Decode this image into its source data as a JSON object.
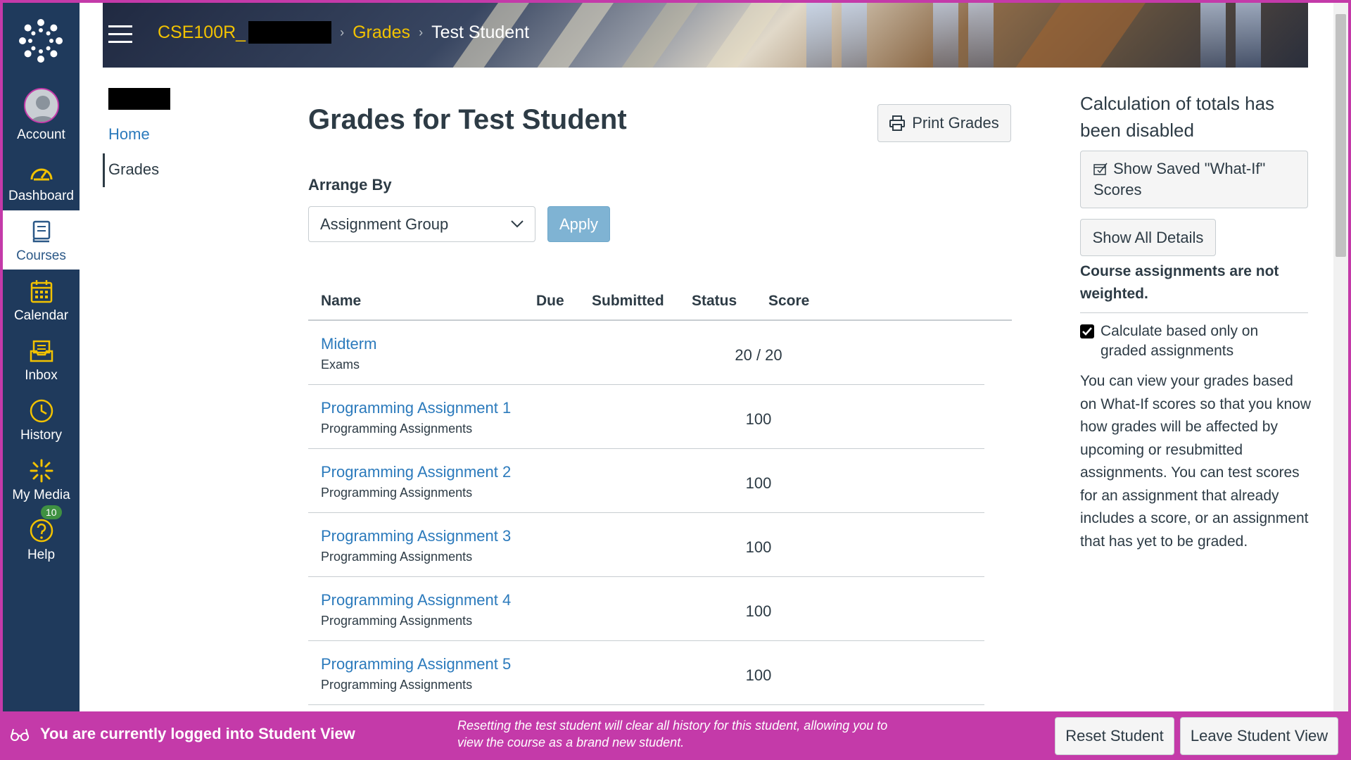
{
  "global_nav": {
    "items": [
      {
        "label": "Account"
      },
      {
        "label": "Dashboard"
      },
      {
        "label": "Courses"
      },
      {
        "label": "Calendar"
      },
      {
        "label": "Inbox"
      },
      {
        "label": "History"
      },
      {
        "label": "My Media"
      },
      {
        "label": "Help",
        "badge": "10"
      }
    ]
  },
  "breadcrumb": {
    "course": "CSE100R_",
    "section": "Grades",
    "current": "Test Student"
  },
  "course_nav": {
    "items": [
      {
        "label": "Home"
      },
      {
        "label": "Grades"
      }
    ]
  },
  "main": {
    "title": "Grades for Test Student",
    "print_label": "Print Grades",
    "arrange_label": "Arrange By",
    "arrange_value": "Assignment Group",
    "apply_label": "Apply",
    "columns": [
      "Name",
      "Due",
      "Submitted",
      "Status",
      "Score"
    ],
    "rows": [
      {
        "name": "Midterm",
        "group": "Exams",
        "score": "20 / 20"
      },
      {
        "name": "Programming Assignment 1",
        "group": "Programming Assignments",
        "score": "100"
      },
      {
        "name": "Programming Assignment 2",
        "group": "Programming Assignments",
        "score": "100"
      },
      {
        "name": "Programming Assignment 3",
        "group": "Programming Assignments",
        "score": "100"
      },
      {
        "name": "Programming Assignment 4",
        "group": "Programming Assignments",
        "score": "100"
      },
      {
        "name": "Programming Assignment 5",
        "group": "Programming Assignments",
        "score": "100"
      }
    ]
  },
  "sidebar": {
    "title": "Calculation of totals has been disabled",
    "whatif_button": "Show Saved \"What-If\" Scores",
    "details_button": "Show All Details",
    "weights_note": "Course assignments are not weighted.",
    "checkbox_label": "Calculate based only on graded assignments",
    "checkbox_checked": true,
    "whatif_text": "You can view your grades based on What-If scores so that you know how grades will be affected by upcoming or resubmitted assignments. You can test scores for an assignment that already includes a score, or an assignment that has yet to be graded."
  },
  "student_view": {
    "message": "You are currently logged into Student View",
    "note": "Resetting the test student will clear all history for this student, allowing you to view the course as a brand new student.",
    "reset_label": "Reset Student",
    "leave_label": "Leave Student View"
  },
  "colors": {
    "nav_bg": "#1f3a5c",
    "accent_yellow": "#f2c200",
    "link": "#2b7abc",
    "student_view": "#c43aa9",
    "apply_bg": "#7fb3d3"
  }
}
